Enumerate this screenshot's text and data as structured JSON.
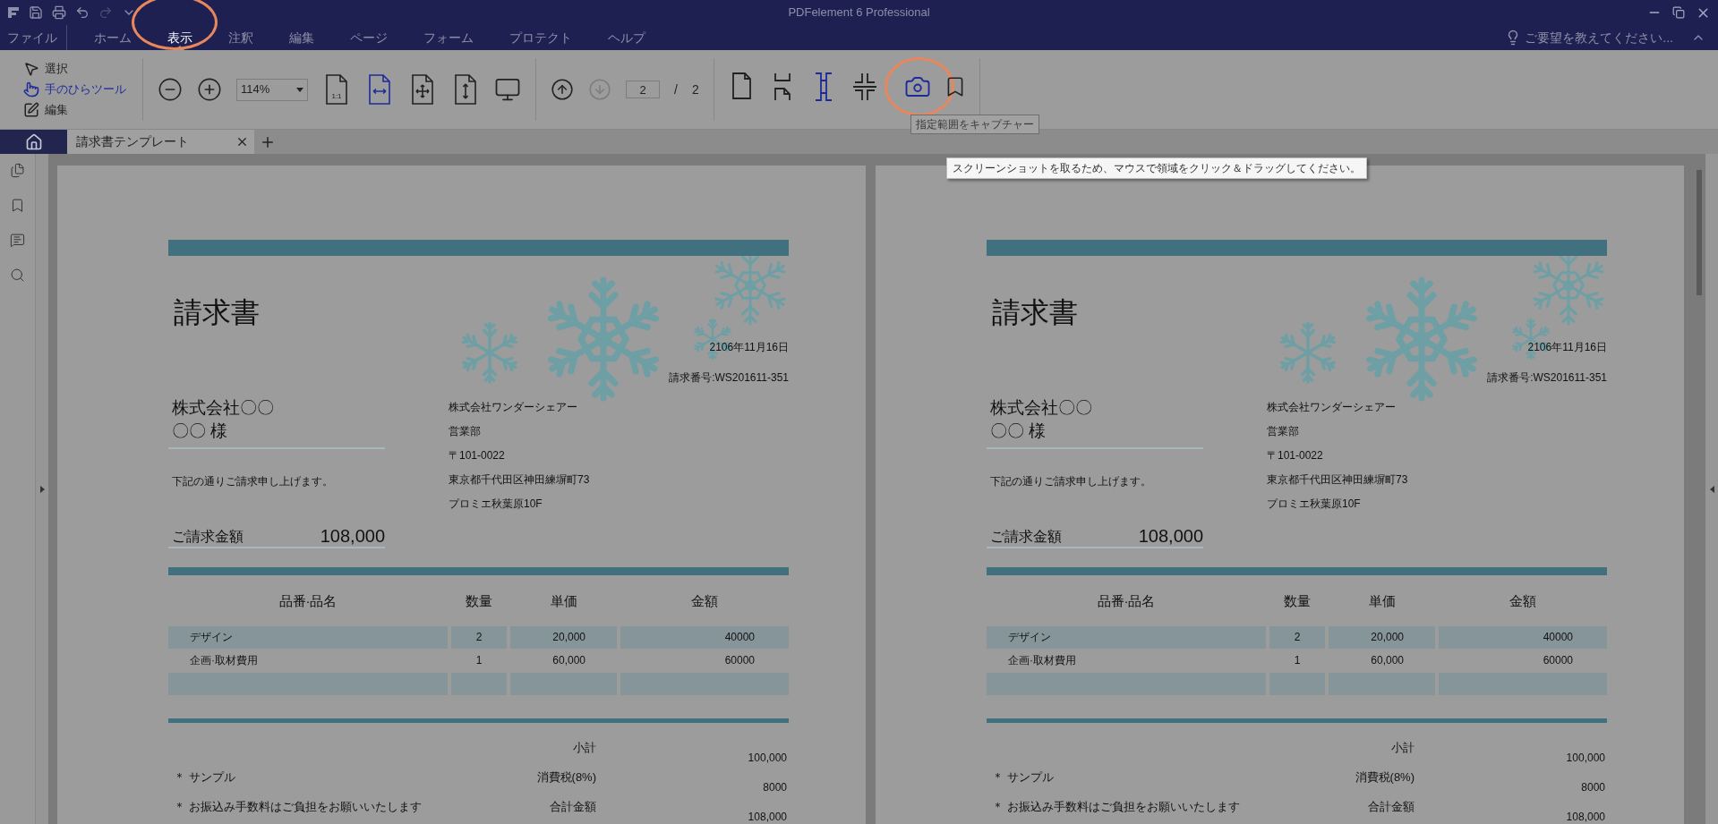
{
  "title_bar": {
    "title": "PDFelement 6 Professional",
    "quick_actions": [
      {
        "kind": "save",
        "disabled": false
      },
      {
        "kind": "print",
        "disabled": false
      },
      {
        "kind": "undo",
        "disabled": false
      },
      {
        "kind": "redo",
        "disabled": true
      },
      {
        "kind": "customize",
        "disabled": false
      }
    ]
  },
  "menu": [
    {
      "label": "ファイル",
      "selected": false,
      "circled": false
    },
    {
      "label": "ホーム",
      "selected": false,
      "circled": false
    },
    {
      "label": "表示",
      "selected": true,
      "circled": true
    },
    {
      "label": "注釈",
      "selected": false,
      "circled": false
    },
    {
      "label": "編集",
      "selected": false,
      "circled": false
    },
    {
      "label": "ページ",
      "selected": false,
      "circled": false
    },
    {
      "label": "フォーム",
      "selected": false,
      "circled": false
    },
    {
      "label": "プロテクト",
      "selected": false,
      "circled": false
    },
    {
      "label": "ヘルプ",
      "selected": false,
      "circled": false
    }
  ],
  "feedback": "ご要望を教えてください...",
  "toolbar": {
    "modes": [
      {
        "kind": "select",
        "label": "選択",
        "selected": false
      },
      {
        "kind": "hand",
        "label": "手のひらツール",
        "selected": true
      },
      {
        "kind": "edit",
        "label": "編集",
        "selected": false
      }
    ],
    "zoom_buttons": [
      {
        "kind": "zoom_out"
      },
      {
        "kind": "zoom_in"
      }
    ],
    "zoom": "114%",
    "view_buttons": [
      {
        "kind": "actual_size",
        "label": "1:1",
        "selected": false
      },
      {
        "kind": "fit_width",
        "selected": true
      },
      {
        "kind": "fit_page",
        "selected": false
      },
      {
        "kind": "fit_height",
        "selected": false
      },
      {
        "kind": "full_screen",
        "selected": false
      }
    ],
    "nav": [
      {
        "kind": "up",
        "disabled": false
      },
      {
        "kind": "down",
        "disabled": true
      }
    ],
    "page_field": "2",
    "page_separator": "/",
    "page_total": "2",
    "layout_buttons": [
      {
        "kind": "single",
        "selected": false,
        "circled": false
      },
      {
        "kind": "continuous",
        "selected": false,
        "circled": false
      },
      {
        "kind": "two_page",
        "selected": true,
        "circled": false
      },
      {
        "kind": "two_page_continuous",
        "selected": false,
        "circled": false
      },
      {
        "kind": "capture",
        "selected": true,
        "circled": true
      },
      {
        "kind": "bookmark",
        "selected": false,
        "circled": false
      }
    ]
  },
  "tooltips": [
    {
      "kind": "label",
      "text": "指定範囲をキャプチャー"
    },
    {
      "kind": "hint",
      "text": "スクリーンショットを取るため、マウスで領域をクリック＆ドラッグしてください。"
    }
  ],
  "tabs": [
    {
      "label": "請求書テンプレート",
      "selected": true
    }
  ],
  "sidebar": [
    {
      "kind": "pages"
    },
    {
      "kind": "bookmarks"
    },
    {
      "kind": "comments"
    },
    {
      "kind": "search"
    }
  ],
  "pages": [
    {
      "title": "請求書",
      "date": "2106年11月16日",
      "invoice_no": "請求番号:WS201611-351",
      "client": "株式会社〇〇",
      "client_person": "〇〇 様",
      "greeting": "下記の通りご請求申し上げます。",
      "amount_label": "ご請求金額",
      "amount": "108,000",
      "sender_lines": [
        "株式会社ワンダーシェアー",
        "営業部",
        "〒101-0022",
        "東京都千代田区神田練塀町73",
        "プロミエ秋葉原10F"
      ],
      "columns": [
        "品番·品名",
        "数量",
        "単価",
        "金額"
      ],
      "rows": [
        {
          "kind": "item",
          "cells": [
            "デザイン",
            "2",
            "20,000",
            "40000"
          ]
        },
        {
          "kind": "item",
          "cells": [
            "企画·取材費用",
            "1",
            "60,000",
            "60000"
          ]
        },
        {
          "kind": "blank"
        }
      ],
      "notes": [
        "＊ サンプル",
        "＊ お振込み手数料はご負担をお願いいたします"
      ],
      "totals": [
        {
          "label": "小計",
          "value": "100,000"
        },
        {
          "label": "消費税(8%)",
          "value": "8000"
        },
        {
          "label": "合計金額",
          "value": "108,000"
        }
      ]
    },
    {
      "title": "請求書",
      "date": "2106年11月16日",
      "invoice_no": "請求番号:WS201611-351",
      "client": "株式会社〇〇",
      "client_person": "〇〇 様",
      "greeting": "下記の通りご請求申し上げます。",
      "amount_label": "ご請求金額",
      "amount": "108,000",
      "sender_lines": [
        "株式会社ワンダーシェアー",
        "営業部",
        "〒101-0022",
        "東京都千代田区神田練塀町73",
        "プロミエ秋葉原10F"
      ],
      "columns": [
        "品番·品名",
        "数量",
        "単価",
        "金額"
      ],
      "rows": [
        {
          "kind": "item",
          "cells": [
            "デザイン",
            "2",
            "20,000",
            "40000"
          ]
        },
        {
          "kind": "item",
          "cells": [
            "企画·取材費用",
            "1",
            "60,000",
            "60000"
          ]
        },
        {
          "kind": "blank"
        }
      ],
      "notes": [
        "＊ サンプル",
        "＊ お振込み手数料はご負担をお願いいたします"
      ],
      "totals": [
        {
          "label": "小計",
          "value": "100,000"
        },
        {
          "label": "消費税(8%)",
          "value": "8000"
        },
        {
          "label": "合計金額",
          "value": "108,000"
        }
      ]
    }
  ]
}
